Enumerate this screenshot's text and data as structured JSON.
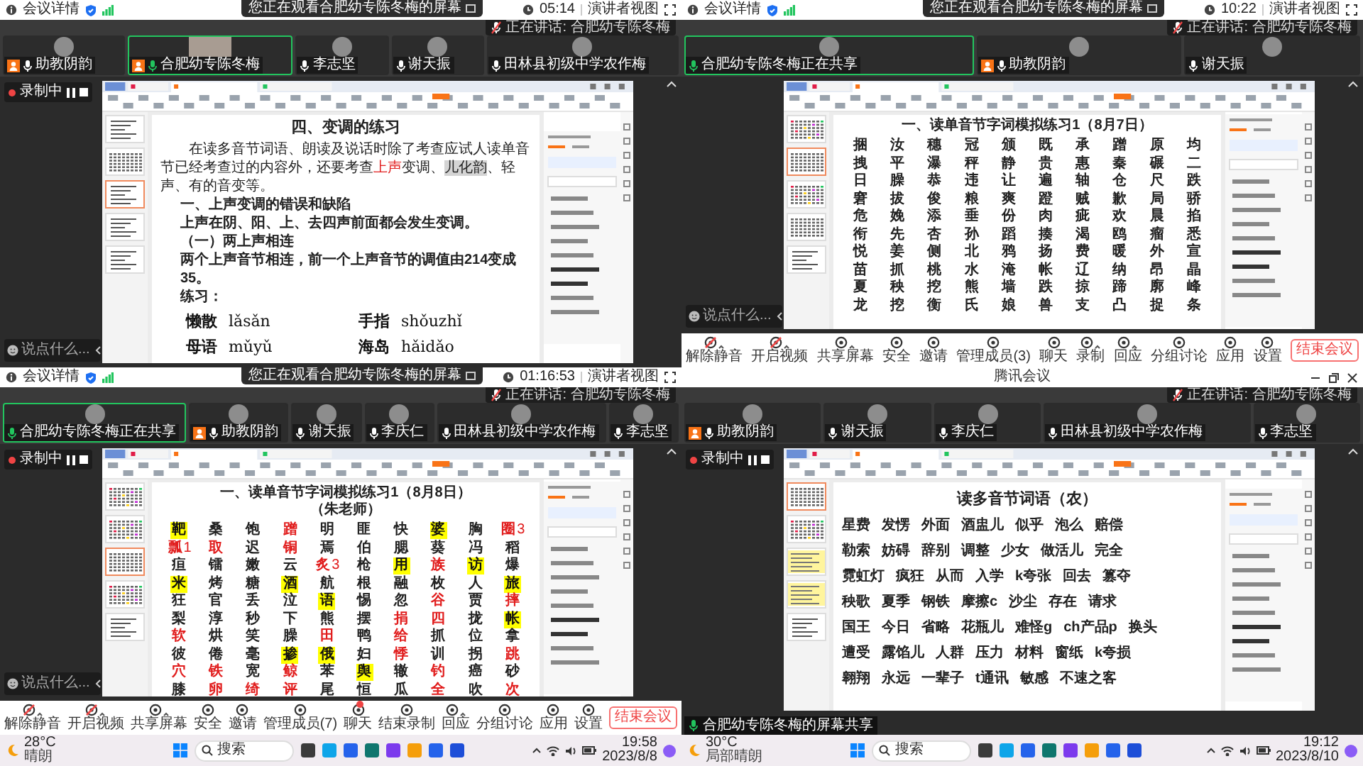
{
  "panels": [
    {
      "banner": "您正在观看合肥幼专陈冬梅的屏幕",
      "header": {
        "title": "会议详情",
        "time": "05:14",
        "view": "演讲者视图"
      },
      "recording": "录制中",
      "participants": [
        {
          "name": "助教阴韵",
          "host": true,
          "video": false,
          "active": false
        },
        {
          "name": "合肥幼专陈冬梅",
          "host": true,
          "video": true,
          "active": true
        },
        {
          "name": "李志坚",
          "host": false,
          "video": false,
          "active": false
        },
        {
          "name": "谢天振",
          "host": false,
          "video": false,
          "active": false
        },
        {
          "name": "田林县初级中学农作梅",
          "host": false,
          "video": false,
          "active": false
        }
      ],
      "speaking": {
        "label": "正在讲话:",
        "name": "合肥幼专陈冬梅"
      },
      "chat_placeholder": "说点什么...",
      "thumbnails": [
        {
          "kind": "text",
          "selected": false
        },
        {
          "kind": "grid",
          "selected": false
        },
        {
          "kind": "text",
          "selected": true
        },
        {
          "kind": "text",
          "selected": false
        },
        {
          "kind": "text",
          "selected": false
        }
      ],
      "document": {
        "kind": "passage",
        "title": "四、变调的练习",
        "paragraph": [
          {
            "text": "在读多音节词语、朗读及说话时除了考查应试人读单音节已经考查过的内容外，还要考查",
            "kind": "plain"
          },
          {
            "text": "上声",
            "kind": "red"
          },
          {
            "text": "变调、",
            "kind": "plain"
          },
          {
            "text": "儿化韵",
            "kind": "boxed"
          },
          {
            "text": "、轻声、有的音变等。",
            "kind": "plain"
          }
        ],
        "lines": [
          "一、上声变调的错误和缺陷",
          "上声在阴、阳、上、去四声前面都会发生变调。",
          "（一）两上声相连",
          "两个上声音节相连，前一个上声音节的调值由214变成35。",
          "练习："
        ],
        "pairs": [
          {
            "word": "懒散",
            "pinyin": "lǎsǎn"
          },
          {
            "word": "手指",
            "pinyin": "shǒuzhǐ"
          },
          {
            "word": "母语",
            "pinyin": "mǔyǔ"
          },
          {
            "word": "海岛",
            "pinyin": "hǎidǎo"
          }
        ]
      }
    },
    {
      "banner": "您正在观看合肥幼专陈冬梅的屏幕",
      "header": {
        "title": "会议详情",
        "time": "10:22",
        "view": "演讲者视图"
      },
      "participants": [
        {
          "name": "合肥幼专陈冬梅正在共享",
          "host": false,
          "video": false,
          "active": true
        },
        {
          "name": "助教阴韵",
          "host": true,
          "video": false,
          "active": false
        },
        {
          "name": "谢天振",
          "host": false,
          "video": false,
          "active": false
        }
      ],
      "speaking": {
        "label": "正在讲话:",
        "name": "合肥幼专陈冬梅"
      },
      "chat_placeholder": "说点什么...",
      "thumbnails": [
        {
          "kind": "color",
          "selected": false
        },
        {
          "kind": "grid",
          "selected": true
        },
        {
          "kind": "color",
          "selected": false
        },
        {
          "kind": "grid",
          "selected": false
        },
        {
          "kind": "text",
          "selected": false
        }
      ],
      "document": {
        "kind": "grid",
        "title": "一、读单音节字词模拟练习1（8月7日）",
        "rows": [
          [
            "捆",
            "汝",
            "穗",
            "冠",
            "颁",
            "既",
            "承",
            "蹭",
            "原",
            "均"
          ],
          [
            "拽",
            "平",
            "瀑",
            "秤",
            "静",
            "贵",
            "惠",
            "秦",
            "碾",
            "二"
          ],
          [
            "日",
            "臊",
            "恭",
            "违",
            "让",
            "遍",
            "轴",
            "仓",
            "尺",
            "跌"
          ],
          [
            "窘",
            "拔",
            "俊",
            "粮",
            "爽",
            "蹬",
            "贼",
            "歉",
            "局",
            "骄"
          ],
          [
            "危",
            "娩",
            "添",
            "垂",
            "份",
            "肉",
            "疵",
            "欢",
            "晨",
            "掐"
          ],
          [
            "衔",
            "先",
            "杏",
            "孙",
            "蹈",
            "揍",
            "渴",
            "鸥",
            "瘤",
            "悉"
          ],
          [
            "悦",
            "姜",
            "侧",
            "北",
            "鸦",
            "扬",
            "费",
            "暖",
            "外",
            "宣"
          ],
          [
            "苗",
            "抓",
            "桃",
            "水",
            "淹",
            "帐",
            "辽",
            "纳",
            "昂",
            "晶"
          ],
          [
            "夏",
            "秧",
            "挖",
            "熊",
            "墙",
            "跌",
            "掠",
            "蹄",
            "廓",
            "峰"
          ],
          [
            "龙",
            "挖",
            "衡",
            "氏",
            "娘",
            "兽",
            "支",
            "凸",
            "捉",
            "条"
          ]
        ]
      },
      "toolbar": {
        "items": [
          {
            "label": "解除静音",
            "off": true,
            "menu": true,
            "unread": false
          },
          {
            "label": "开启视频",
            "off": true,
            "menu": true,
            "unread": false
          },
          {
            "label": "共享屏幕",
            "off": false,
            "menu": true,
            "unread": false
          },
          {
            "label": "安全",
            "off": false,
            "menu": false,
            "unread": false
          },
          {
            "label": "邀请",
            "off": false,
            "menu": false,
            "unread": false
          },
          {
            "label": "管理成员(3)",
            "off": false,
            "menu": false,
            "unread": false
          },
          {
            "label": "聊天",
            "off": false,
            "menu": false,
            "unread": false
          },
          {
            "label": "录制",
            "off": false,
            "menu": true,
            "unread": false
          },
          {
            "label": "回应",
            "off": false,
            "menu": true,
            "unread": false
          },
          {
            "label": "分组讨论",
            "off": false,
            "menu": false,
            "unread": false
          },
          {
            "label": "应用",
            "off": false,
            "menu": false,
            "unread": false
          },
          {
            "label": "设置",
            "off": false,
            "menu": false,
            "unread": false
          }
        ],
        "end": "结束会议"
      }
    },
    {
      "banner": "您正在观看合肥幼专陈冬梅的屏幕",
      "header": {
        "title": "会议详情",
        "time": "01:16:53",
        "view": "演讲者视图"
      },
      "recording": "录制中",
      "participants": [
        {
          "name": "合肥幼专陈冬梅正在共享",
          "host": false,
          "video": false,
          "active": true
        },
        {
          "name": "助教阴韵",
          "host": true,
          "video": false,
          "active": false
        },
        {
          "name": "谢天振",
          "host": false,
          "video": false,
          "active": false
        },
        {
          "name": "李庆仁",
          "host": false,
          "video": false,
          "active": false
        },
        {
          "name": "田林县初级中学农作梅",
          "host": false,
          "video": false,
          "active": false
        },
        {
          "name": "李志坚",
          "host": false,
          "video": false,
          "active": false
        }
      ],
      "speaking": {
        "label": "正在讲话:",
        "name": "合肥幼专陈冬梅"
      },
      "chat_placeholder": "说点什么...",
      "thumbnails": [
        {
          "kind": "color",
          "selected": false
        },
        {
          "kind": "color",
          "selected": false
        },
        {
          "kind": "grid",
          "selected": true
        },
        {
          "kind": "color",
          "selected": false
        },
        {
          "kind": "text",
          "selected": false
        }
      ],
      "document": {
        "kind": "grid",
        "title": "一、读单音节字词模拟练习1（8月8日）",
        "subtitle": "（朱老师）",
        "rows": [
          [
            {
              "text": "靶",
              "kind": "highlight"
            },
            "桑",
            "饱",
            {
              "text": "蹭",
              "kind": "red"
            },
            "明",
            "匪",
            "快",
            {
              "text": "婆",
              "kind": "highlight"
            },
            "胸",
            {
              "text": "圈",
              "kind": "red",
              "note": "3"
            }
          ],
          [
            {
              "text": "瓢",
              "kind": "red",
              "note": "1"
            },
            {
              "text": "取",
              "kind": "red"
            },
            "迟",
            {
              "text": "铜",
              "kind": "red"
            },
            "焉",
            "伯",
            "腮",
            "葵",
            "冯",
            "稻"
          ],
          [
            "疸",
            "镭",
            "嫩",
            "云",
            {
              "text": "炙",
              "kind": "red",
              "note": "3"
            },
            "枪",
            {
              "text": "用",
              "kind": "highlight"
            },
            {
              "text": "族",
              "kind": "red"
            },
            {
              "text": "访",
              "kind": "highlight"
            },
            "爆"
          ],
          [
            {
              "text": "米",
              "kind": "highlight"
            },
            "烤",
            "糖",
            {
              "text": "酒",
              "kind": "highlight"
            },
            "航",
            "根",
            "融",
            "枚",
            "人",
            {
              "text": "旅",
              "kind": "highlight"
            }
          ],
          [
            "狂",
            "官",
            "丢",
            "泣",
            {
              "text": "语",
              "kind": "highlight"
            },
            "惕",
            "忽",
            {
              "text": "谷",
              "kind": "red"
            },
            "贾",
            {
              "text": "摔",
              "kind": "red"
            }
          ],
          [
            "梨",
            "淳",
            "秒",
            "下",
            "熊",
            "摆",
            {
              "text": "捐",
              "kind": "red"
            },
            {
              "text": "四",
              "kind": "red"
            },
            "拢",
            {
              "text": "帐",
              "kind": "highlight"
            }
          ],
          [
            {
              "text": "软",
              "kind": "red"
            },
            "烘",
            "笑",
            "臊",
            {
              "text": "田",
              "kind": "red"
            },
            "鸭",
            {
              "text": "给",
              "kind": "red"
            },
            "抓",
            "位",
            "拿"
          ],
          [
            "彼",
            "倦",
            "毫",
            {
              "text": "掺",
              "kind": "highlight"
            },
            {
              "text": "俄",
              "kind": "highlight"
            },
            "妇",
            {
              "text": "悸",
              "kind": "red"
            },
            "训",
            "拐",
            {
              "text": "跳",
              "kind": "red"
            }
          ],
          [
            {
              "text": "穴",
              "kind": "red"
            },
            {
              "text": "铁",
              "kind": "red"
            },
            "宽",
            {
              "text": "鲸",
              "kind": "red"
            },
            "苯",
            {
              "text": "舆",
              "kind": "highlight"
            },
            "辙",
            {
              "text": "钓",
              "kind": "red"
            },
            "癌",
            "砂"
          ],
          [
            "膝",
            {
              "text": "卵",
              "kind": "red"
            },
            {
              "text": "绮",
              "kind": "red"
            },
            {
              "text": "评",
              "kind": "red"
            },
            "尾",
            "恒",
            "瓜",
            {
              "text": "全",
              "kind": "red"
            },
            "吹",
            {
              "text": "次",
              "kind": "red"
            }
          ]
        ]
      },
      "toolbar": {
        "items": [
          {
            "label": "解除静音",
            "off": true,
            "menu": true,
            "unread": false
          },
          {
            "label": "开启视频",
            "off": true,
            "menu": true,
            "unread": false
          },
          {
            "label": "共享屏幕",
            "off": false,
            "menu": true,
            "unread": false
          },
          {
            "label": "安全",
            "off": false,
            "menu": false,
            "unread": false
          },
          {
            "label": "邀请",
            "off": false,
            "menu": false,
            "unread": false
          },
          {
            "label": "管理成员(7)",
            "off": false,
            "menu": false,
            "unread": false
          },
          {
            "label": "聊天",
            "off": false,
            "menu": false,
            "unread": true
          },
          {
            "label": "结束录制",
            "off": false,
            "menu": false,
            "unread": false
          },
          {
            "label": "回应",
            "off": false,
            "menu": true,
            "unread": false
          },
          {
            "label": "分组讨论",
            "off": false,
            "menu": false,
            "unread": false
          },
          {
            "label": "应用",
            "off": false,
            "menu": false,
            "unread": false
          },
          {
            "label": "设置",
            "off": false,
            "menu": false,
            "unread": false
          }
        ],
        "end": "结束会议"
      }
    },
    {
      "title_bar": "腾讯会议",
      "recording": "录制中",
      "participants": [
        {
          "name": "助教阴韵",
          "host": true,
          "video": false,
          "active": false
        },
        {
          "name": "谢天振",
          "host": false,
          "video": false,
          "active": false
        },
        {
          "name": "李庆仁",
          "host": false,
          "video": false,
          "active": false
        },
        {
          "name": "田林县初级中学农作梅",
          "host": false,
          "video": false,
          "active": false
        },
        {
          "name": "李志坚",
          "host": false,
          "video": false,
          "active": false
        }
      ],
      "speaking": {
        "label": "正在讲话:",
        "name": "合肥幼专陈冬梅"
      },
      "thumbnails": [
        {
          "kind": "grid",
          "selected": true
        },
        {
          "kind": "color",
          "selected": false
        },
        {
          "kind": "yellow",
          "selected": false
        },
        {
          "kind": "yellow",
          "selected": false
        },
        {
          "kind": "text",
          "selected": false
        }
      ],
      "document": {
        "kind": "words",
        "title": "读多音节词语（农）",
        "lines": [
          [
            "星费",
            "发愣",
            "外面",
            "酒盅儿",
            "似乎",
            "泡么",
            "赔偿"
          ],
          [
            "勒索",
            "妨碍",
            "辞别",
            "调整",
            "少女",
            "做活儿",
            "完全"
          ],
          [
            "霓虹灯",
            "疯狂",
            "从而",
            "入学",
            "k夸张",
            "回去",
            "篡夺"
          ],
          [
            "秧歌",
            "夏季",
            "钢铁",
            "摩擦c",
            "沙尘",
            "存在",
            "请求"
          ],
          [
            "国王",
            "今日",
            "省略",
            "花瓶儿",
            "难怪g",
            "ch产品p",
            "换头"
          ],
          [
            "遭受",
            "露馅儿",
            "人群",
            "压力",
            "材料",
            "窗纸",
            "k夸损"
          ],
          [
            "翱翔",
            "永远",
            "一辈子",
            "t通讯",
            "敏感",
            "不速之客"
          ]
        ]
      },
      "footer": "合肥幼专陈冬梅的屏幕共享"
    }
  ],
  "taskbar": [
    {
      "temp": "28°C",
      "weather": "晴朗",
      "placeholder": "搜索",
      "time": "19:58",
      "date": "2023/8/8"
    },
    {
      "temp": "30°C",
      "weather": "局部晴朗",
      "placeholder": "搜索",
      "time": "19:12",
      "date": "2023/8/10"
    }
  ]
}
